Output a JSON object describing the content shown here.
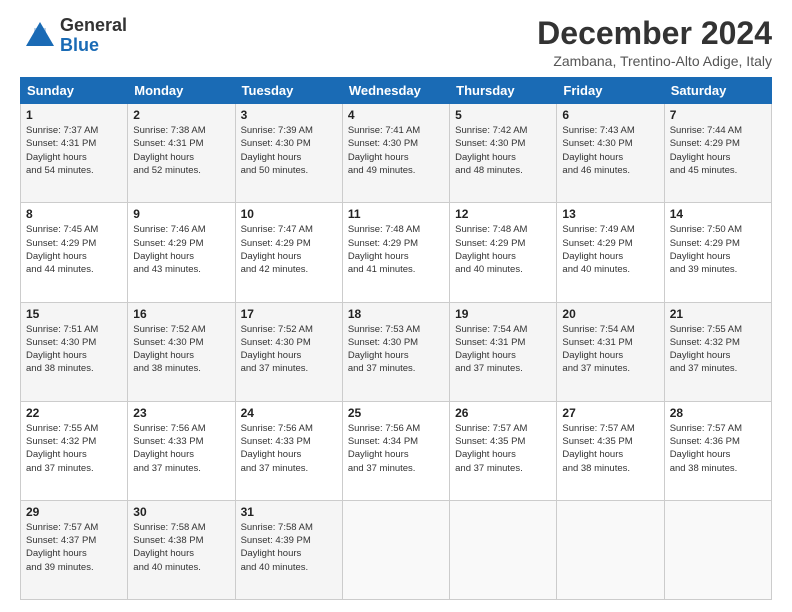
{
  "header": {
    "logo_general": "General",
    "logo_blue": "Blue",
    "title": "December 2024",
    "subtitle": "Zambana, Trentino-Alto Adige, Italy"
  },
  "calendar": {
    "headers": [
      "Sunday",
      "Monday",
      "Tuesday",
      "Wednesday",
      "Thursday",
      "Friday",
      "Saturday"
    ],
    "rows": [
      [
        {
          "num": "1",
          "rise": "7:37 AM",
          "set": "4:31 PM",
          "daylight": "8 hours and 54 minutes."
        },
        {
          "num": "2",
          "rise": "7:38 AM",
          "set": "4:31 PM",
          "daylight": "8 hours and 52 minutes."
        },
        {
          "num": "3",
          "rise": "7:39 AM",
          "set": "4:30 PM",
          "daylight": "8 hours and 50 minutes."
        },
        {
          "num": "4",
          "rise": "7:41 AM",
          "set": "4:30 PM",
          "daylight": "8 hours and 49 minutes."
        },
        {
          "num": "5",
          "rise": "7:42 AM",
          "set": "4:30 PM",
          "daylight": "8 hours and 48 minutes."
        },
        {
          "num": "6",
          "rise": "7:43 AM",
          "set": "4:30 PM",
          "daylight": "8 hours and 46 minutes."
        },
        {
          "num": "7",
          "rise": "7:44 AM",
          "set": "4:29 PM",
          "daylight": "8 hours and 45 minutes."
        }
      ],
      [
        {
          "num": "8",
          "rise": "7:45 AM",
          "set": "4:29 PM",
          "daylight": "8 hours and 44 minutes."
        },
        {
          "num": "9",
          "rise": "7:46 AM",
          "set": "4:29 PM",
          "daylight": "8 hours and 43 minutes."
        },
        {
          "num": "10",
          "rise": "7:47 AM",
          "set": "4:29 PM",
          "daylight": "8 hours and 42 minutes."
        },
        {
          "num": "11",
          "rise": "7:48 AM",
          "set": "4:29 PM",
          "daylight": "8 hours and 41 minutes."
        },
        {
          "num": "12",
          "rise": "7:48 AM",
          "set": "4:29 PM",
          "daylight": "8 hours and 40 minutes."
        },
        {
          "num": "13",
          "rise": "7:49 AM",
          "set": "4:29 PM",
          "daylight": "8 hours and 40 minutes."
        },
        {
          "num": "14",
          "rise": "7:50 AM",
          "set": "4:29 PM",
          "daylight": "8 hours and 39 minutes."
        }
      ],
      [
        {
          "num": "15",
          "rise": "7:51 AM",
          "set": "4:30 PM",
          "daylight": "8 hours and 38 minutes."
        },
        {
          "num": "16",
          "rise": "7:52 AM",
          "set": "4:30 PM",
          "daylight": "8 hours and 38 minutes."
        },
        {
          "num": "17",
          "rise": "7:52 AM",
          "set": "4:30 PM",
          "daylight": "8 hours and 37 minutes."
        },
        {
          "num": "18",
          "rise": "7:53 AM",
          "set": "4:30 PM",
          "daylight": "8 hours and 37 minutes."
        },
        {
          "num": "19",
          "rise": "7:54 AM",
          "set": "4:31 PM",
          "daylight": "8 hours and 37 minutes."
        },
        {
          "num": "20",
          "rise": "7:54 AM",
          "set": "4:31 PM",
          "daylight": "8 hours and 37 minutes."
        },
        {
          "num": "21",
          "rise": "7:55 AM",
          "set": "4:32 PM",
          "daylight": "8 hours and 37 minutes."
        }
      ],
      [
        {
          "num": "22",
          "rise": "7:55 AM",
          "set": "4:32 PM",
          "daylight": "8 hours and 37 minutes."
        },
        {
          "num": "23",
          "rise": "7:56 AM",
          "set": "4:33 PM",
          "daylight": "8 hours and 37 minutes."
        },
        {
          "num": "24",
          "rise": "7:56 AM",
          "set": "4:33 PM",
          "daylight": "8 hours and 37 minutes."
        },
        {
          "num": "25",
          "rise": "7:56 AM",
          "set": "4:34 PM",
          "daylight": "8 hours and 37 minutes."
        },
        {
          "num": "26",
          "rise": "7:57 AM",
          "set": "4:35 PM",
          "daylight": "8 hours and 37 minutes."
        },
        {
          "num": "27",
          "rise": "7:57 AM",
          "set": "4:35 PM",
          "daylight": "8 hours and 38 minutes."
        },
        {
          "num": "28",
          "rise": "7:57 AM",
          "set": "4:36 PM",
          "daylight": "8 hours and 38 minutes."
        }
      ],
      [
        {
          "num": "29",
          "rise": "7:57 AM",
          "set": "4:37 PM",
          "daylight": "8 hours and 39 minutes."
        },
        {
          "num": "30",
          "rise": "7:58 AM",
          "set": "4:38 PM",
          "daylight": "8 hours and 40 minutes."
        },
        {
          "num": "31",
          "rise": "7:58 AM",
          "set": "4:39 PM",
          "daylight": "8 hours and 40 minutes."
        },
        null,
        null,
        null,
        null
      ]
    ]
  }
}
